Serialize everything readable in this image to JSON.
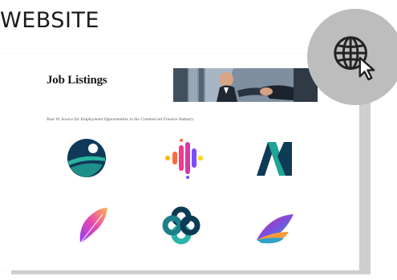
{
  "header": {
    "title": "WEBSITE"
  },
  "site": {
    "title": "Job Listings",
    "tagline": "Your #1 Source for Employment Opportunities in the Commercial Finance Industry."
  },
  "logos": [
    {
      "name": "circle-wave-logo",
      "colors": [
        "#0f3a5a",
        "#2bb3a0",
        "#ffffff"
      ]
    },
    {
      "name": "dotted-bars-logo",
      "colors": [
        "#f23a8f",
        "#ffd400",
        "#7c4dff"
      ]
    },
    {
      "name": "m-shape-logo",
      "colors": [
        "#0e3b56",
        "#1ea597"
      ]
    },
    {
      "name": "feather-logo",
      "colors": [
        "#8f3ffa",
        "#e548b1",
        "#ffb34d"
      ]
    },
    {
      "name": "knot-logo",
      "colors": [
        "#0d3a55",
        "#29b6a8"
      ]
    },
    {
      "name": "wing-logo",
      "colors": [
        "#e0306b",
        "#2ea2c8",
        "#7c4de0"
      ]
    }
  ],
  "icons": {
    "globe_badge": "globe-cursor-icon"
  }
}
